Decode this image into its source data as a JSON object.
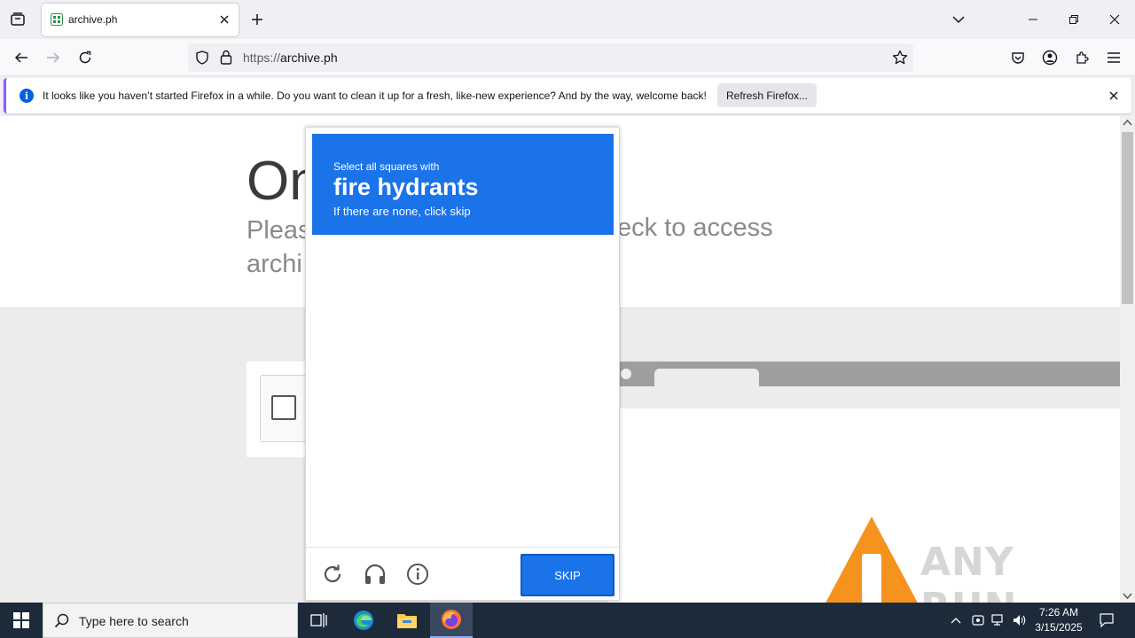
{
  "browser": {
    "tab_title": "archive.ph",
    "url_scheme": "https://",
    "url_host": "archive.ph",
    "accent_color": "#0060df"
  },
  "notification": {
    "message": "It looks like you haven’t started Firefox in a while. Do you want to clean it up for a fresh, like-new experience? And by the way, welcome back!",
    "button_label": "Refresh Firefox..."
  },
  "page": {
    "headline": "On",
    "subline_left": "Pleas",
    "subline_right": "eck to access",
    "subline_second": "archi",
    "watermark": "ANY RUN"
  },
  "captcha": {
    "instruction_prefix": "Select all squares with",
    "target": "fire hydrants",
    "instruction_suffix": "If there are none, click skip",
    "skip_label": "SKIP",
    "header_color": "#1a73e8",
    "footer_icons": [
      "refresh-icon",
      "headphones-icon",
      "info-icon"
    ]
  },
  "taskbar": {
    "search_placeholder": "Type here to search",
    "time": "7:26 AM",
    "date": "3/15/2025",
    "apps": [
      "task-view-icon",
      "edge-icon",
      "file-explorer-icon",
      "firefox-icon"
    ]
  }
}
